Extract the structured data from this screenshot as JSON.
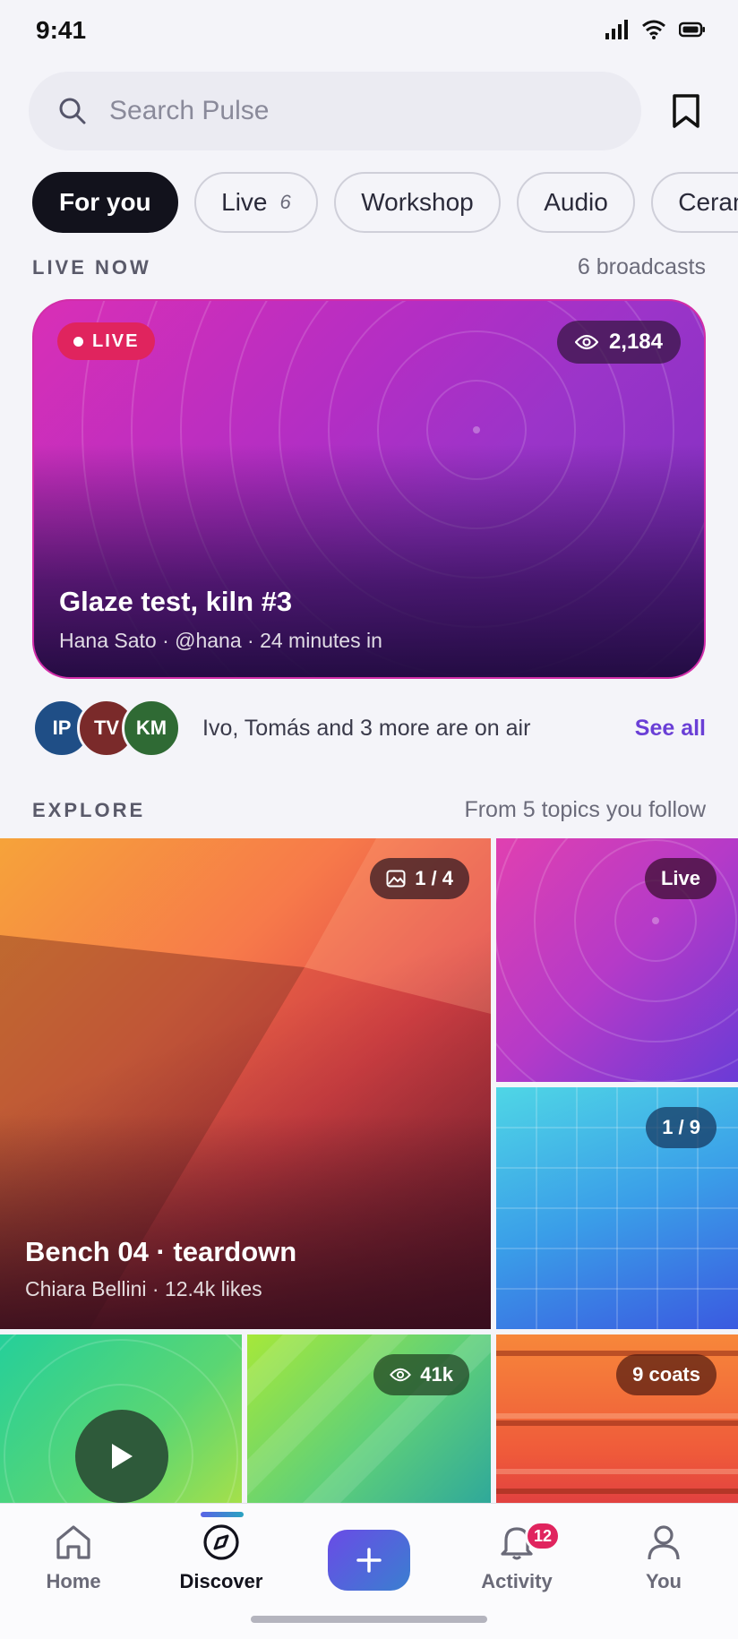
{
  "status_bar": {
    "time": "9:41"
  },
  "search": {
    "placeholder": "Search Pulse"
  },
  "chips": [
    {
      "label": "For you",
      "count": ""
    },
    {
      "label": "Live",
      "count": "6"
    },
    {
      "label": "Workshop",
      "count": ""
    },
    {
      "label": "Audio",
      "count": ""
    },
    {
      "label": "Ceramics",
      "count": ""
    }
  ],
  "live_now": {
    "title": "LIVE NOW",
    "meta": "6 broadcasts",
    "card": {
      "badge": "LIVE",
      "viewers": "2,184",
      "title": "Glaze test, kiln #3",
      "subtitle": "Hana Sato · @hana · 24 minutes in"
    },
    "avatars": [
      {
        "initials": "IP",
        "color": "#1f4e86"
      },
      {
        "initials": "TV",
        "color": "#7a2a2a"
      },
      {
        "initials": "KM",
        "color": "#2f6a34"
      }
    ],
    "on_air_text": "Ivo, Tomás and 3 more are on air",
    "see_all": "See all"
  },
  "explore": {
    "title": "EXPLORE",
    "meta": "From 5 topics you follow",
    "tiles": {
      "main": {
        "counter": "1 / 4",
        "title": "Bench 04 · teardown",
        "subtitle": "Chiara Bellini · 12.4k likes"
      },
      "live": {
        "badge": "Live"
      },
      "grid": {
        "counter": "1 / 9"
      },
      "green": {
        "views": "41k"
      },
      "orange": {
        "badge": "9 coats"
      }
    }
  },
  "tabbar": {
    "home": "Home",
    "discover": "Discover",
    "activity": "Activity",
    "you": "You",
    "notification_count": "12"
  },
  "colors": {
    "accent": "#6a3fd6",
    "live": "#e0245e",
    "dark": "#12121c"
  }
}
